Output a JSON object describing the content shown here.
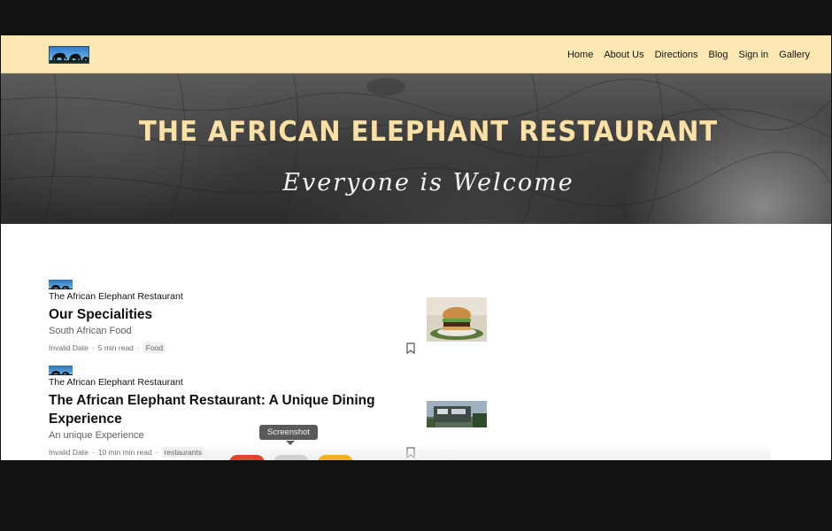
{
  "nav": {
    "items": [
      "Home",
      "About Us",
      "Directions",
      "Blog",
      "Sign in",
      "Gallery"
    ]
  },
  "hero": {
    "title": "THE AFRICAN ELEPHANT RESTAURANT",
    "subtitle": "Everyone is Welcome"
  },
  "articles": [
    {
      "publication": "The African Elephant Restaurant",
      "title": "Our Specialities",
      "subtitle": "South African Food",
      "date": "Invalid Date",
      "read_time": "5 min read",
      "tag": "Food",
      "thumbnail": "burger-image"
    },
    {
      "publication": "The African Elephant Restaurant",
      "title": "The African Elephant Restaurant: A Unique Dining Experience",
      "subtitle": "An unique Experience",
      "date": "Invalid Date",
      "read_time": "10 min min read",
      "tag": "restaurants",
      "thumbnail": "restaurant-exterior-image"
    }
  ],
  "tooltip": {
    "text": "Screenshot"
  },
  "colors": {
    "header_bg": "#fde8b4",
    "hero_title": "#fbe1a6",
    "frame_bg": "#121212"
  },
  "icons": [
    "elephant-logo-icon",
    "bookmark-icon"
  ]
}
